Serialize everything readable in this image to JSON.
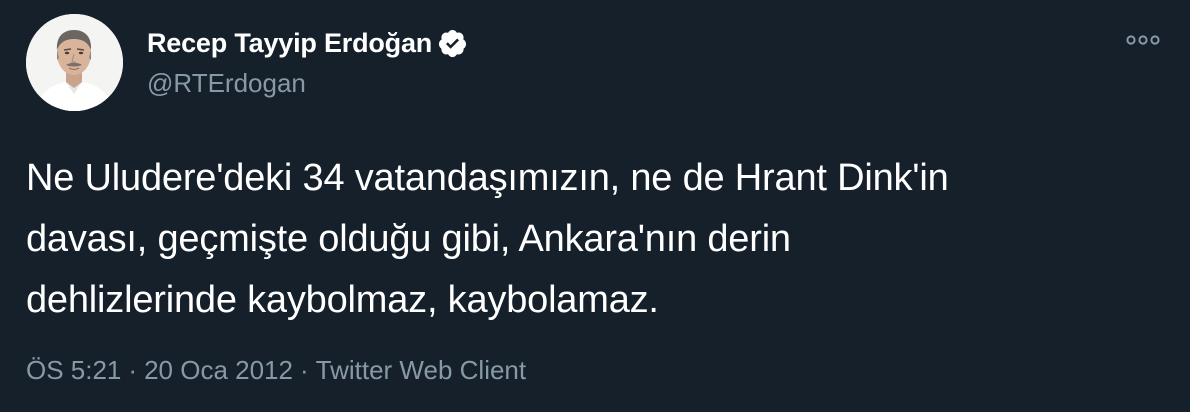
{
  "author": {
    "display_name": "Recep Tayyip Erdoğan",
    "handle": "@RTErdogan",
    "verified": true
  },
  "tweet": {
    "lines": [
      "Ne Uludere'deki 34 vatandaşımızın, ne de Hrant Dink'in",
      "davası, geçmişte olduğu gibi, Ankara'nın derin",
      "dehlizlerinde kaybolmaz, kaybolamaz."
    ]
  },
  "meta": {
    "time": "ÖS 5:21",
    "separator": "·",
    "date": "20 Oca 2012",
    "source": "Twitter Web Client"
  },
  "icons": {
    "verified": "verified-badge-icon",
    "more": "more-options-icon"
  },
  "colors": {
    "background": "#15202b",
    "primary_text": "#ffffff",
    "secondary_text": "#8899a6",
    "verified_badge": "#ffffff"
  }
}
